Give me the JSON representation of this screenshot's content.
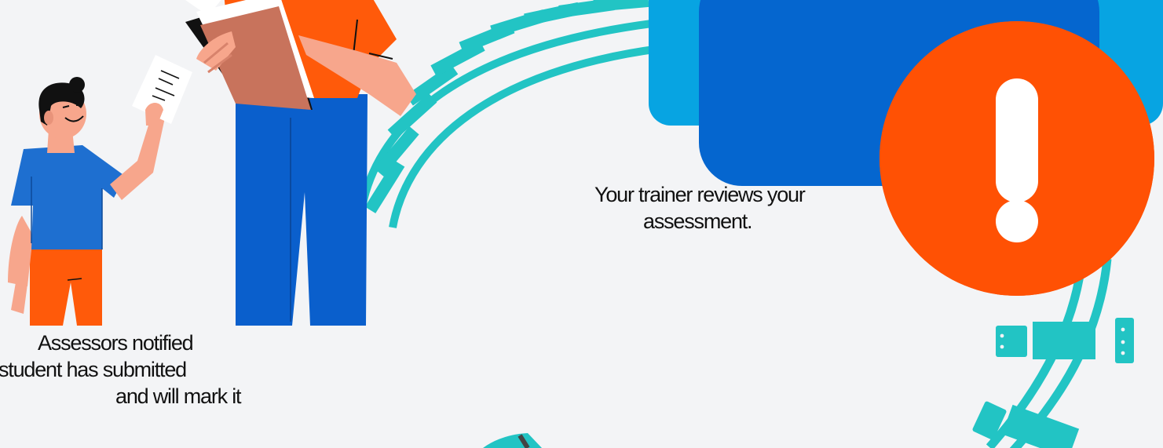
{
  "captions": {
    "assessors_notified": {
      "line1": "Assessors notified",
      "line2": "student has submitted",
      "line3": "and will mark it"
    },
    "trainer_reviews": {
      "line1": "Your trainer reviews your",
      "line2": "assessment."
    }
  },
  "icons": [
    "exclamation-icon",
    "document-icon",
    "clipboard-icon"
  ],
  "colors": {
    "background": "#f3f4f6",
    "track_teal": "#22c4c4",
    "alert_orange": "#ff5104",
    "trainer_shirt": "#ff5a0a",
    "pants_blue": "#0a5fcc",
    "student_shirt": "#1e6fd0",
    "monitor_outer": "#07a4e2",
    "monitor_inner": "#0566cf",
    "skin": "#f7a68c",
    "clipboard": "#c8735c"
  }
}
